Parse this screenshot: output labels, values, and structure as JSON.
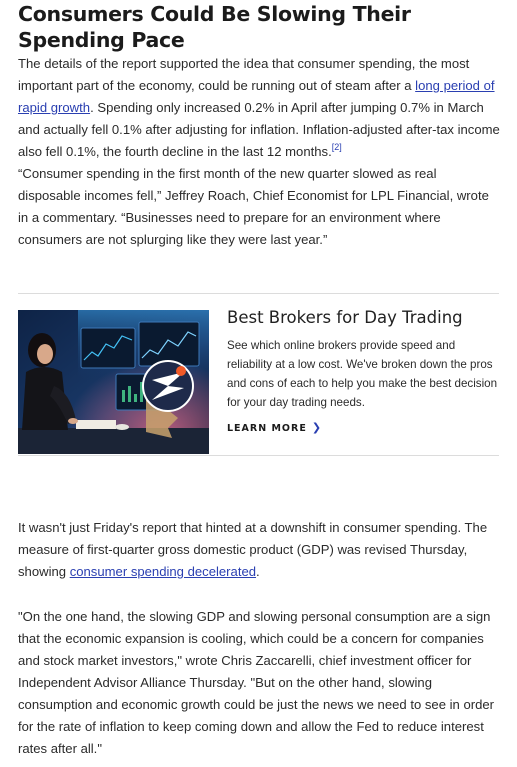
{
  "article": {
    "heading": "Consumers Could Be Slowing Their Spending Pace",
    "para1": {
      "before_link": "The details of the report supported the idea that consumer spending, the most important part of the economy, could be running out of steam after a ",
      "link_text": "long period of rapid growth",
      "after_link": ". Spending only increased 0.2% in April after jumping 0.7% in March and actually fell 0.1% after adjusting for inflation. Inflation-adjusted after-tax income also fell 0.1%, the fourth decline in the last 12 months.",
      "footnote": "[2]"
    },
    "para2": "“Consumer spending in the first month of the new quarter slowed as real disposable incomes fell,” Jeffrey Roach, Chief Economist for LPL Financial, wrote in a commentary. “Businesses need to prepare for an environment where consumers are not splurging like they were last year.”",
    "para3": {
      "before_link": "It wasn't just Friday's report that hinted at a downshift in consumer spending. The measure of first-quarter gross domestic product (GDP) was revised Thursday, showing ",
      "link_text": "consumer spending decelerated",
      "after_link": "."
    },
    "para4": "\"On the one hand, the slowing GDP and slowing personal consumption are a sign that the economic expansion is cooling, which could be a concern for companies and stock market investors,\" wrote Chris Zaccarelli, chief investment officer for Independent Advisor Alliance Thursday. \"But on the other hand, slowing consumption and economic growth could be just the news we need to see in order for the rate of inflation to keep coming down and allow the Fed to reduce interest rates after all.\""
  },
  "promo": {
    "title": "Best Brokers for Day Trading",
    "description": "See which online brokers provide speed and reliability at a low cost. We've broken down the pros and cons of each to help you make the best decision for your day trading needs.",
    "cta": "LEARN MORE",
    "cta_icon": "chevron-right-icon",
    "image_subject": "woman-at-trading-desk-with-logo-badge"
  },
  "colors": {
    "link": "#2a3fb1",
    "text": "#2b2b2b",
    "badge_navy": "#1e2a4a",
    "badge_orange": "#f05a28"
  }
}
